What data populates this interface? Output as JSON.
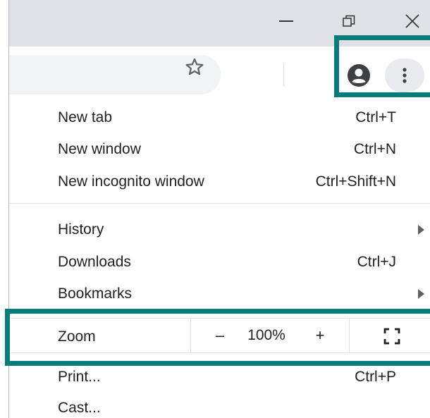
{
  "window": {
    "minimize_icon": "minimize-icon",
    "restore_icon": "restore-icon",
    "close_icon": "close-icon"
  },
  "toolbar": {
    "bookmark_icon": "star-icon",
    "profile_icon": "account-circle-icon",
    "menu_icon": "more-vert-icon"
  },
  "menu": {
    "items": [
      {
        "label": "New tab",
        "shortcut": "Ctrl+T"
      },
      {
        "label": "New window",
        "shortcut": "Ctrl+N"
      },
      {
        "label": "New incognito window",
        "shortcut": "Ctrl+Shift+N"
      },
      {
        "label": "History",
        "shortcut": ""
      },
      {
        "label": "Downloads",
        "shortcut": "Ctrl+J"
      },
      {
        "label": "Bookmarks",
        "shortcut": ""
      }
    ],
    "zoom": {
      "label": "Zoom",
      "minus": "–",
      "value": "100%",
      "plus": "+",
      "fullscreen_icon": "fullscreen-icon"
    },
    "bottom_items": [
      {
        "label": "Print...",
        "shortcut": "Ctrl+P"
      },
      {
        "label": "Cast...",
        "shortcut": ""
      }
    ]
  },
  "colors": {
    "highlight": "#087b7b",
    "titlebar": "#dee1e6",
    "omnibox": "#f1f3f4"
  }
}
